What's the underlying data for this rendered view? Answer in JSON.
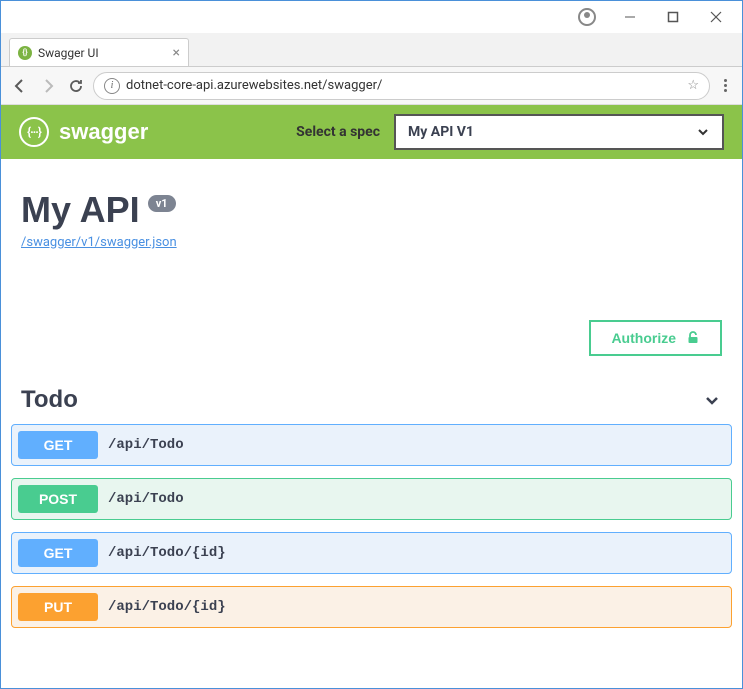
{
  "window": {
    "tab_title": "Swagger UI"
  },
  "browser": {
    "url": "dotnet-core-api.azurewebsites.net/swagger/"
  },
  "header": {
    "brand": "swagger",
    "spec_label": "Select a spec",
    "spec_selected": "My API V1"
  },
  "info": {
    "title": "My API",
    "version": "v1",
    "swagger_json_link": "/swagger/v1/swagger.json"
  },
  "authorize": {
    "label": "Authorize"
  },
  "tag": {
    "name": "Todo",
    "operations": [
      {
        "method": "GET",
        "path": "/api/Todo"
      },
      {
        "method": "POST",
        "path": "/api/Todo"
      },
      {
        "method": "GET",
        "path": "/api/Todo/{id}"
      },
      {
        "method": "PUT",
        "path": "/api/Todo/{id}"
      }
    ]
  }
}
